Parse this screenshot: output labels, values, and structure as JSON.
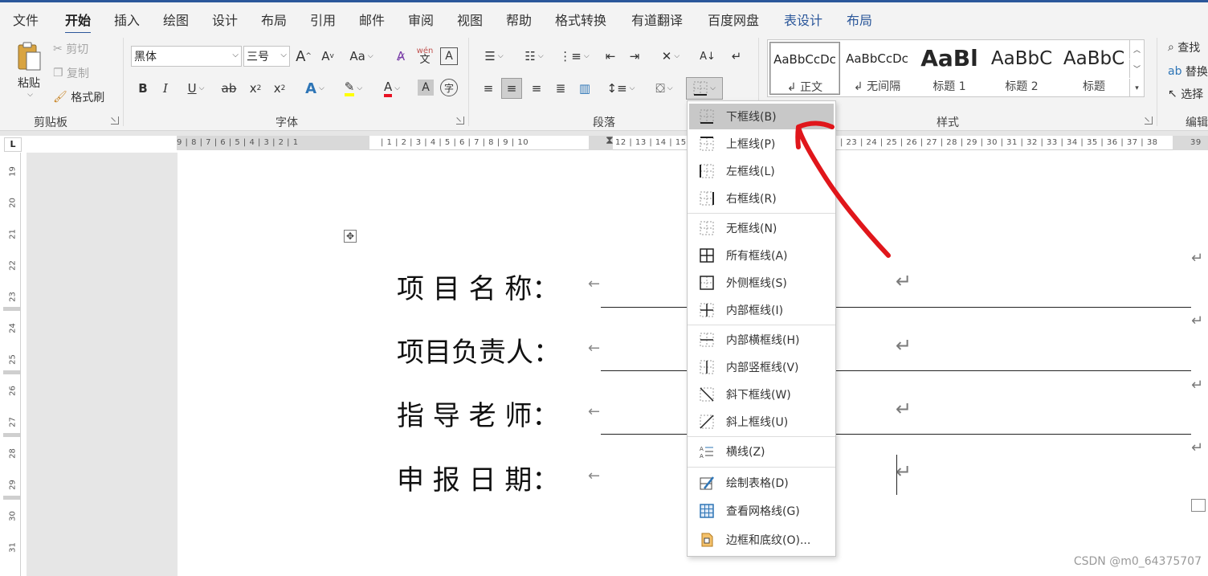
{
  "tabs": [
    "文件",
    "开始",
    "插入",
    "绘图",
    "设计",
    "布局",
    "引用",
    "邮件",
    "审阅",
    "视图",
    "帮助",
    "格式转换",
    "有道翻译",
    "百度网盘",
    "表设计",
    "布局"
  ],
  "active_tab": "开始",
  "colors": {
    "accent": "#2b579a",
    "ribbon_bg": "#f3f3f3",
    "annotation_arrow": "#e0161b",
    "highlight_yellow": "#ffff00",
    "font_red": "#e81123"
  },
  "clipboard": {
    "group_label": "剪贴板",
    "paste": "粘贴",
    "cut": "剪切",
    "copy": "复制",
    "format_painter": "格式刷"
  },
  "font": {
    "group_label": "字体",
    "font_name": "黑体",
    "font_size": "三号",
    "grow": "A",
    "shrink": "A",
    "change_case": "Aa",
    "wen": "wén",
    "wen_char": "文",
    "bold": "B",
    "italic": "I",
    "underline": "U",
    "strike": "ab",
    "subscript": "x",
    "superscript": "x",
    "effects": "A",
    "color_a": "A",
    "shade_a": "A",
    "enclose": "字"
  },
  "paragraph": {
    "group_label": "段落"
  },
  "styles": {
    "group_label": "样式",
    "items": [
      {
        "sample": "AaBbCcDc",
        "name": "正文"
      },
      {
        "sample": "AaBbCcDc",
        "name": "无间隔"
      },
      {
        "sample": "AaBl",
        "name": "标题 1"
      },
      {
        "sample": "AaBbC",
        "name": "标题 2"
      },
      {
        "sample": "AaBbC",
        "name": "标题"
      }
    ]
  },
  "editing": {
    "group_label": "编辑",
    "find": "查找",
    "replace": "替换",
    "select": "选择"
  },
  "ruler": {
    "left_numbers": "9 | 8 | 7 | 6 | 5 | 4 | 3 | 2 | 1",
    "right_numbers": "| 1 | 2 | 3 | 4 | 5 | 6 | 7 | 8 | 9 | 10",
    "far_numbers": "| 23 | 24 | 25 | 26 | 27 | 28 | 29 | 30 | 31 | 32 | 33 | 34 | 35 | 36 | 37 | 38",
    "tail": "39",
    "mid_numbers": "12 | 13 | 14 | 15",
    "vertical": [
      "19",
      "20",
      "21",
      "22",
      "23",
      "24",
      "25",
      "26",
      "27",
      "28",
      "29",
      "30",
      "31"
    ],
    "tab_selector": "L"
  },
  "document": {
    "rows": [
      {
        "label": "项 目 名 称："
      },
      {
        "label": "项目负责人："
      },
      {
        "label": "指 导 老 师："
      },
      {
        "label": "申 报 日 期："
      }
    ],
    "cell_mark": "←",
    "para_mark": "↵",
    "move_handle": "✥"
  },
  "border_menu": {
    "items": [
      {
        "label": "下框线(B)",
        "icon": "bottom-border-icon"
      },
      {
        "label": "上框线(P)",
        "icon": "top-border-icon"
      },
      {
        "label": "左框线(L)",
        "icon": "left-border-icon"
      },
      {
        "label": "右框线(R)",
        "icon": "right-border-icon"
      },
      {
        "label": "无框线(N)",
        "icon": "no-border-icon"
      },
      {
        "label": "所有框线(A)",
        "icon": "all-borders-icon"
      },
      {
        "label": "外侧框线(S)",
        "icon": "outside-borders-icon"
      },
      {
        "label": "内部框线(I)",
        "icon": "inside-borders-icon"
      },
      {
        "label": "内部横框线(H)",
        "icon": "inside-horizontal-border-icon"
      },
      {
        "label": "内部竖框线(V)",
        "icon": "inside-vertical-border-icon"
      },
      {
        "label": "斜下框线(W)",
        "icon": "diagonal-down-border-icon"
      },
      {
        "label": "斜上框线(U)",
        "icon": "diagonal-up-border-icon"
      },
      {
        "label": "横线(Z)",
        "icon": "horizontal-line-icon"
      },
      {
        "label": "绘制表格(D)",
        "icon": "draw-table-icon"
      },
      {
        "label": "查看网格线(G)",
        "icon": "view-gridlines-icon"
      },
      {
        "label": "边框和底纹(O)...",
        "icon": "borders-and-shading-icon"
      }
    ],
    "hovered": "下框线(B)"
  },
  "watermark": "CSDN @m0_64375707"
}
